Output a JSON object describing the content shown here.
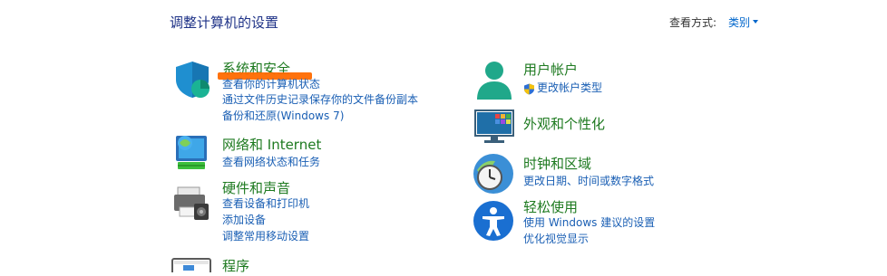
{
  "header": {
    "title": "调整计算机的设置",
    "view_by_label": "查看方式:",
    "view_by_value": "类别"
  },
  "categories": {
    "security": {
      "title": "系统和安全",
      "links": [
        "查看你的计算机状态",
        "通过文件历史记录保存你的文件备份副本",
        "备份和还原(Windows 7)"
      ]
    },
    "network": {
      "title": "网络和 Internet",
      "links": [
        "查看网络状态和任务"
      ]
    },
    "hardware": {
      "title": "硬件和声音",
      "links": [
        "查看设备和打印机",
        "添加设备",
        "调整常用移动设置"
      ]
    },
    "programs": {
      "title": "程序"
    },
    "accounts": {
      "title": "用户帐户",
      "links": [
        "更改帐户类型"
      ]
    },
    "appearance": {
      "title": "外观和个性化"
    },
    "clock": {
      "title": "时钟和区域",
      "links": [
        "更改日期、时间或数字格式"
      ]
    },
    "ease": {
      "title": "轻松使用",
      "links": [
        "使用 Windows 建议的设置",
        "优化视觉显示"
      ]
    }
  },
  "colors": {
    "title": "#1e3287",
    "category": "#1e7a20",
    "link": "#1a5fb4",
    "annotation": "#ff6a00"
  }
}
